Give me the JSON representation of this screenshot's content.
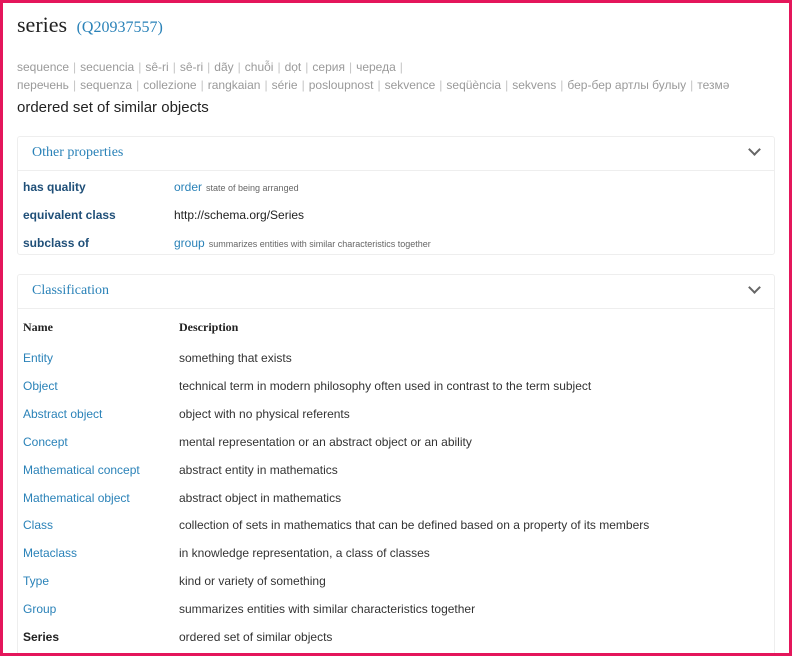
{
  "page": {
    "title": "series",
    "qid": "(Q20937557)",
    "description": "ordered set of similar objects"
  },
  "aliases": [
    "sequence",
    "secuencia",
    "sê-ri",
    "sê-ri",
    "dãy",
    "chuỗi",
    "dọt",
    "серия",
    "череда",
    "перечень",
    "sequenza",
    "collezione",
    "rangkaian",
    "série",
    "posloupnost",
    "sekvence",
    "seqüència",
    "sekvens",
    "бер-бер артлы булыу",
    "тезмә"
  ],
  "other_properties": {
    "title": "Other properties",
    "rows": [
      {
        "name": "has quality",
        "value": "order",
        "note": "state of being arranged",
        "is_link": true
      },
      {
        "name": "equivalent class",
        "value": "http://schema.org/Series",
        "note": "",
        "is_link": false
      },
      {
        "name": "subclass of",
        "value": "group",
        "note": "summarizes entities with similar characteristics together",
        "is_link": true
      }
    ]
  },
  "classification": {
    "title": "Classification",
    "headers": {
      "name": "Name",
      "description": "Description"
    },
    "rows": [
      {
        "name": "Entity",
        "description": "something that exists",
        "current": false
      },
      {
        "name": "Object",
        "description": "technical term in modern philosophy often used in contrast to the term subject",
        "current": false
      },
      {
        "name": "Abstract object",
        "description": "object with no physical referents",
        "current": false
      },
      {
        "name": "Concept",
        "description": "mental representation or an abstract object or an ability",
        "current": false
      },
      {
        "name": "Mathematical concept",
        "description": "abstract entity in mathematics",
        "current": false
      },
      {
        "name": "Mathematical object",
        "description": "abstract object in mathematics",
        "current": false
      },
      {
        "name": "Class",
        "description": "collection of sets in mathematics that can be defined based on a property of its members",
        "current": false
      },
      {
        "name": "Metaclass",
        "description": "in knowledge representation, a class of classes",
        "current": false
      },
      {
        "name": "Type",
        "description": "kind or variety of something",
        "current": false
      },
      {
        "name": "Group",
        "description": "summarizes entities with similar characteristics together",
        "current": false
      },
      {
        "name": "Series",
        "description": "ordered set of similar objects",
        "current": true
      }
    ]
  },
  "colors": {
    "accent": "#2a82b8",
    "frame": "#e4165b",
    "property_label": "#1f4f78"
  }
}
